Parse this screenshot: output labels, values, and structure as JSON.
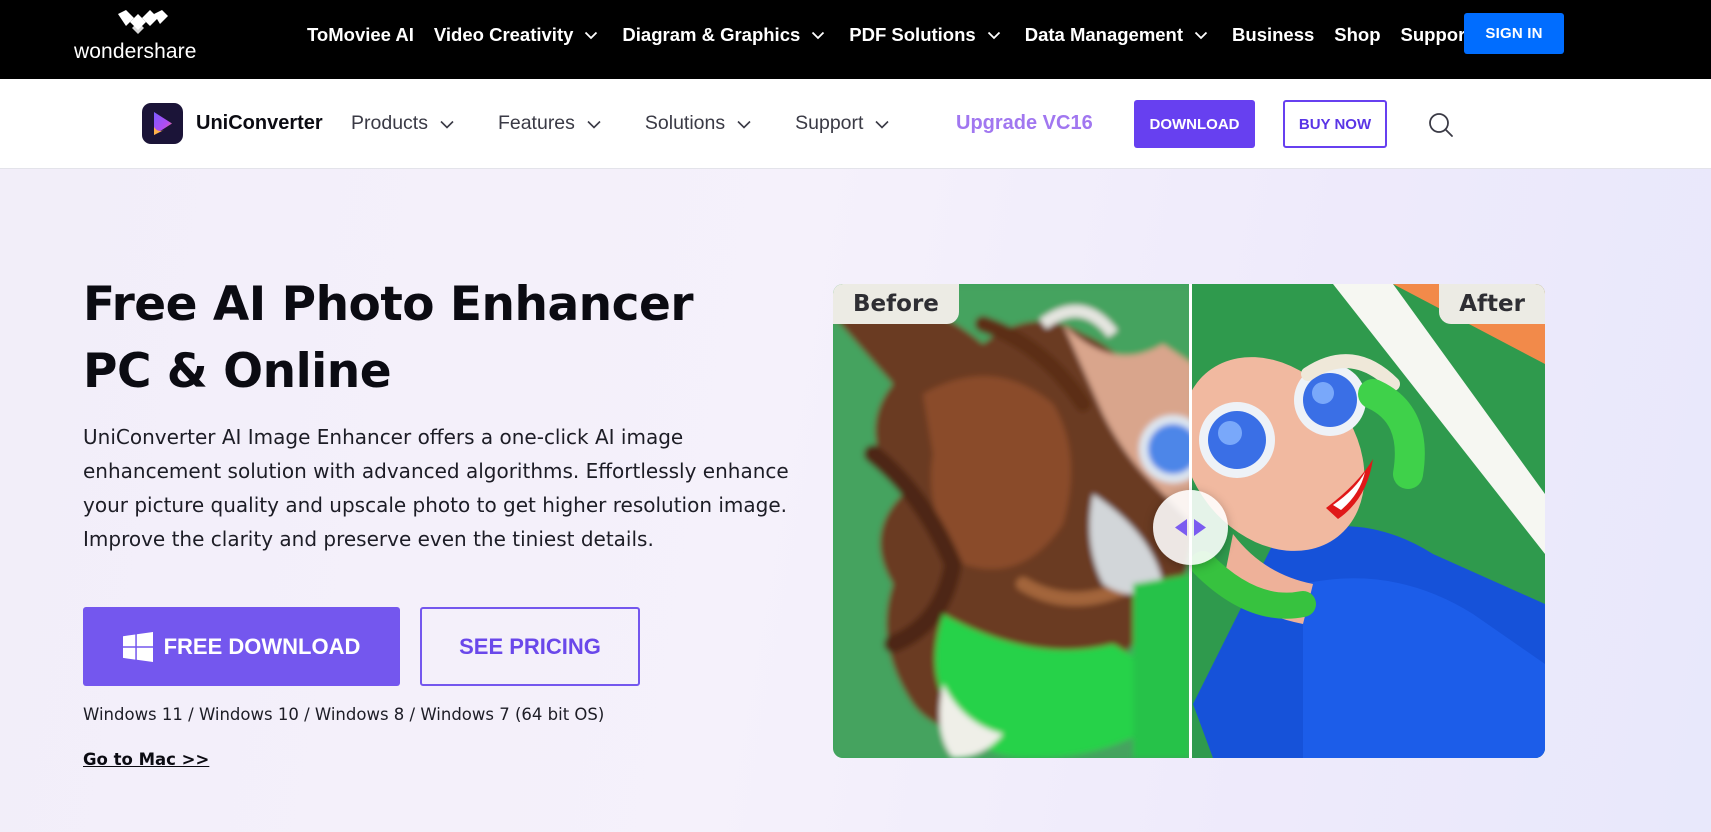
{
  "topbar": {
    "brand": "wondershare",
    "nav": [
      {
        "label": "ToMoviee AI",
        "dropdown": false
      },
      {
        "label": "Video Creativity",
        "dropdown": true
      },
      {
        "label": "Diagram & Graphics",
        "dropdown": true
      },
      {
        "label": "PDF Solutions",
        "dropdown": true
      },
      {
        "label": "Data Management",
        "dropdown": true
      },
      {
        "label": "Business",
        "dropdown": false
      },
      {
        "label": "Shop",
        "dropdown": false
      },
      {
        "label": "Support",
        "dropdown": false
      }
    ],
    "signin_label": "SIGN IN"
  },
  "subnav": {
    "product_name": "UniConverter",
    "menu": [
      {
        "label": "Products"
      },
      {
        "label": "Features"
      },
      {
        "label": "Solutions"
      },
      {
        "label": "Support"
      }
    ],
    "upgrade_label": "Upgrade VC16",
    "download_label": "DOWNLOAD",
    "buy_label": "BUY NOW"
  },
  "hero": {
    "title_line1": "Free AI Photo Enhancer",
    "title_line2": "PC & Online",
    "description": "UniConverter AI Image Enhancer offers a one-click AI image enhancement solution with advanced algorithms. Effortlessly enhance your picture quality and upscale photo to get higher resolution image. Improve the clarity and preserve even the tiniest details.",
    "free_download_label": "FREE DOWNLOAD",
    "see_pricing_label": "SEE PRICING",
    "os_note": "Windows 11 / Windows 10 / Windows 8 / Windows 7 (64 bit OS)",
    "mac_link": "Go to Mac >>"
  },
  "compare": {
    "before_label": "Before",
    "after_label": "After"
  },
  "colors": {
    "topbar_bg": "#000000",
    "signin_blue": "#006dff",
    "brand_purple": "#6740f0",
    "upgrade_purple": "#a177f0",
    "hero_button_purple": "#7457ee"
  },
  "icons": {
    "brand_logo": "wondershare-logo-icon",
    "product_logo": "uniconverter-logo-icon",
    "search": "search-icon",
    "dropdown": "chevron-down-icon",
    "windows": "windows-icon",
    "slider_handle": "left-right-arrows-icon"
  }
}
